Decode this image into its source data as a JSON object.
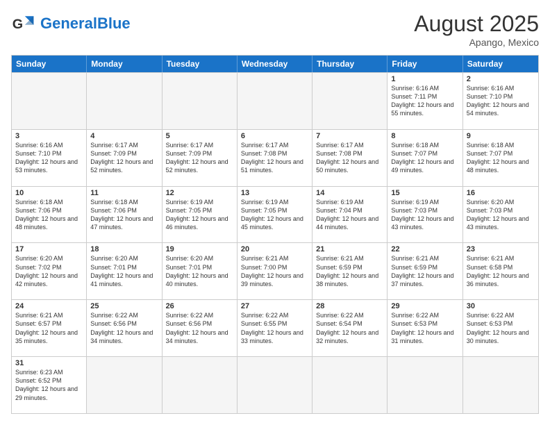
{
  "header": {
    "logo_general": "General",
    "logo_blue": "Blue",
    "month_title": "August 2025",
    "subtitle": "Apango, Mexico"
  },
  "weekdays": [
    "Sunday",
    "Monday",
    "Tuesday",
    "Wednesday",
    "Thursday",
    "Friday",
    "Saturday"
  ],
  "weeks": [
    [
      {
        "day": "",
        "info": "",
        "empty": true
      },
      {
        "day": "",
        "info": "",
        "empty": true
      },
      {
        "day": "",
        "info": "",
        "empty": true
      },
      {
        "day": "",
        "info": "",
        "empty": true
      },
      {
        "day": "",
        "info": "",
        "empty": true
      },
      {
        "day": "1",
        "info": "Sunrise: 6:16 AM\nSunset: 7:11 PM\nDaylight: 12 hours\nand 55 minutes."
      },
      {
        "day": "2",
        "info": "Sunrise: 6:16 AM\nSunset: 7:10 PM\nDaylight: 12 hours\nand 54 minutes."
      }
    ],
    [
      {
        "day": "3",
        "info": "Sunrise: 6:16 AM\nSunset: 7:10 PM\nDaylight: 12 hours\nand 53 minutes."
      },
      {
        "day": "4",
        "info": "Sunrise: 6:17 AM\nSunset: 7:09 PM\nDaylight: 12 hours\nand 52 minutes."
      },
      {
        "day": "5",
        "info": "Sunrise: 6:17 AM\nSunset: 7:09 PM\nDaylight: 12 hours\nand 52 minutes."
      },
      {
        "day": "6",
        "info": "Sunrise: 6:17 AM\nSunset: 7:08 PM\nDaylight: 12 hours\nand 51 minutes."
      },
      {
        "day": "7",
        "info": "Sunrise: 6:17 AM\nSunset: 7:08 PM\nDaylight: 12 hours\nand 50 minutes."
      },
      {
        "day": "8",
        "info": "Sunrise: 6:18 AM\nSunset: 7:07 PM\nDaylight: 12 hours\nand 49 minutes."
      },
      {
        "day": "9",
        "info": "Sunrise: 6:18 AM\nSunset: 7:07 PM\nDaylight: 12 hours\nand 48 minutes."
      }
    ],
    [
      {
        "day": "10",
        "info": "Sunrise: 6:18 AM\nSunset: 7:06 PM\nDaylight: 12 hours\nand 48 minutes."
      },
      {
        "day": "11",
        "info": "Sunrise: 6:18 AM\nSunset: 7:06 PM\nDaylight: 12 hours\nand 47 minutes."
      },
      {
        "day": "12",
        "info": "Sunrise: 6:19 AM\nSunset: 7:05 PM\nDaylight: 12 hours\nand 46 minutes."
      },
      {
        "day": "13",
        "info": "Sunrise: 6:19 AM\nSunset: 7:05 PM\nDaylight: 12 hours\nand 45 minutes."
      },
      {
        "day": "14",
        "info": "Sunrise: 6:19 AM\nSunset: 7:04 PM\nDaylight: 12 hours\nand 44 minutes."
      },
      {
        "day": "15",
        "info": "Sunrise: 6:19 AM\nSunset: 7:03 PM\nDaylight: 12 hours\nand 43 minutes."
      },
      {
        "day": "16",
        "info": "Sunrise: 6:20 AM\nSunset: 7:03 PM\nDaylight: 12 hours\nand 43 minutes."
      }
    ],
    [
      {
        "day": "17",
        "info": "Sunrise: 6:20 AM\nSunset: 7:02 PM\nDaylight: 12 hours\nand 42 minutes."
      },
      {
        "day": "18",
        "info": "Sunrise: 6:20 AM\nSunset: 7:01 PM\nDaylight: 12 hours\nand 41 minutes."
      },
      {
        "day": "19",
        "info": "Sunrise: 6:20 AM\nSunset: 7:01 PM\nDaylight: 12 hours\nand 40 minutes."
      },
      {
        "day": "20",
        "info": "Sunrise: 6:21 AM\nSunset: 7:00 PM\nDaylight: 12 hours\nand 39 minutes."
      },
      {
        "day": "21",
        "info": "Sunrise: 6:21 AM\nSunset: 6:59 PM\nDaylight: 12 hours\nand 38 minutes."
      },
      {
        "day": "22",
        "info": "Sunrise: 6:21 AM\nSunset: 6:59 PM\nDaylight: 12 hours\nand 37 minutes."
      },
      {
        "day": "23",
        "info": "Sunrise: 6:21 AM\nSunset: 6:58 PM\nDaylight: 12 hours\nand 36 minutes."
      }
    ],
    [
      {
        "day": "24",
        "info": "Sunrise: 6:21 AM\nSunset: 6:57 PM\nDaylight: 12 hours\nand 35 minutes."
      },
      {
        "day": "25",
        "info": "Sunrise: 6:22 AM\nSunset: 6:56 PM\nDaylight: 12 hours\nand 34 minutes."
      },
      {
        "day": "26",
        "info": "Sunrise: 6:22 AM\nSunset: 6:56 PM\nDaylight: 12 hours\nand 34 minutes."
      },
      {
        "day": "27",
        "info": "Sunrise: 6:22 AM\nSunset: 6:55 PM\nDaylight: 12 hours\nand 33 minutes."
      },
      {
        "day": "28",
        "info": "Sunrise: 6:22 AM\nSunset: 6:54 PM\nDaylight: 12 hours\nand 32 minutes."
      },
      {
        "day": "29",
        "info": "Sunrise: 6:22 AM\nSunset: 6:53 PM\nDaylight: 12 hours\nand 31 minutes."
      },
      {
        "day": "30",
        "info": "Sunrise: 6:22 AM\nSunset: 6:53 PM\nDaylight: 12 hours\nand 30 minutes."
      }
    ],
    [
      {
        "day": "31",
        "info": "Sunrise: 6:23 AM\nSunset: 6:52 PM\nDaylight: 12 hours\nand 29 minutes."
      },
      {
        "day": "",
        "info": "",
        "empty": true
      },
      {
        "day": "",
        "info": "",
        "empty": true
      },
      {
        "day": "",
        "info": "",
        "empty": true
      },
      {
        "day": "",
        "info": "",
        "empty": true
      },
      {
        "day": "",
        "info": "",
        "empty": true
      },
      {
        "day": "",
        "info": "",
        "empty": true
      }
    ]
  ]
}
